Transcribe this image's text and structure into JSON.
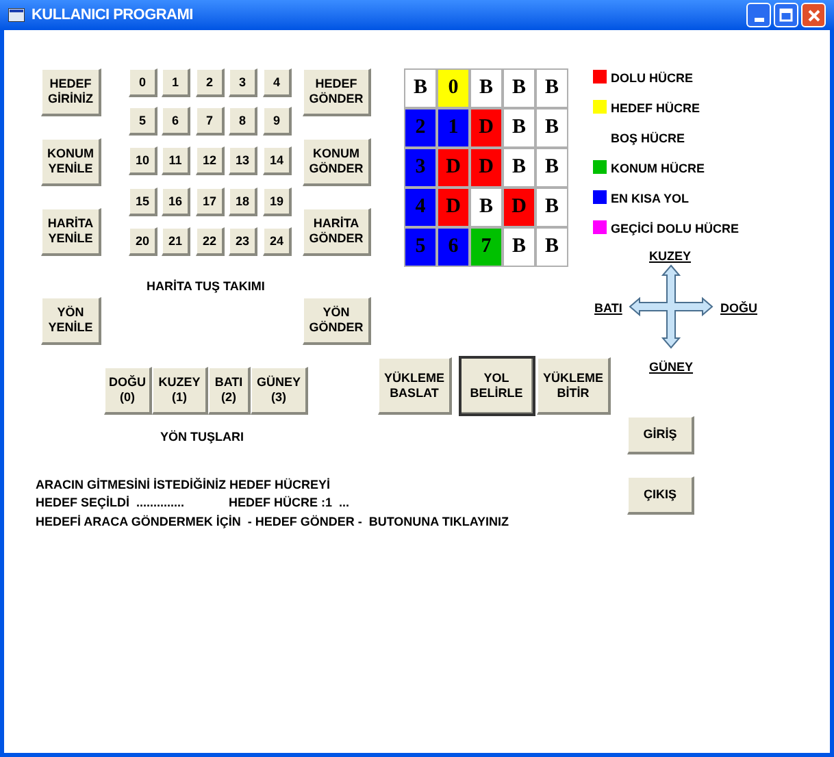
{
  "window": {
    "title": "KULLANICI PROGRAMI"
  },
  "left_buttons": [
    "HEDEF GİRİNİZ",
    "KONUM YENİLE",
    "HARİTA YENİLE",
    "YÖN YENİLE"
  ],
  "right_buttons": [
    "HEDEF GÖNDER",
    "KONUM GÖNDER",
    "HARİTA GÖNDER",
    "YÖN GÖNDER"
  ],
  "keypad": {
    "keys": [
      "0",
      "1",
      "2",
      "3",
      "4",
      "5",
      "6",
      "7",
      "8",
      "9",
      "10",
      "11",
      "12",
      "13",
      "14",
      "15",
      "16",
      "17",
      "18",
      "19",
      "20",
      "21",
      "22",
      "23",
      "24"
    ],
    "label": "HARİTA TUŞ TAKIMI"
  },
  "map_grid": [
    [
      {
        "text": "B",
        "color": "#ffffff"
      },
      {
        "text": "0",
        "color": "#ffff00"
      },
      {
        "text": "B",
        "color": "#ffffff"
      },
      {
        "text": "B",
        "color": "#ffffff"
      },
      {
        "text": "B",
        "color": "#ffffff"
      }
    ],
    [
      {
        "text": "2",
        "color": "#0000ff"
      },
      {
        "text": "1",
        "color": "#0000ff"
      },
      {
        "text": "D",
        "color": "#ff0000"
      },
      {
        "text": "B",
        "color": "#ffffff"
      },
      {
        "text": "B",
        "color": "#ffffff"
      }
    ],
    [
      {
        "text": "3",
        "color": "#0000ff"
      },
      {
        "text": "D",
        "color": "#ff0000"
      },
      {
        "text": "D",
        "color": "#ff0000"
      },
      {
        "text": "B",
        "color": "#ffffff"
      },
      {
        "text": "B",
        "color": "#ffffff"
      }
    ],
    [
      {
        "text": "4",
        "color": "#0000ff"
      },
      {
        "text": "D",
        "color": "#ff0000"
      },
      {
        "text": "B",
        "color": "#ffffff"
      },
      {
        "text": "D",
        "color": "#ff0000"
      },
      {
        "text": "B",
        "color": "#ffffff"
      }
    ],
    [
      {
        "text": "5",
        "color": "#0000ff"
      },
      {
        "text": "6",
        "color": "#0000ff"
      },
      {
        "text": "7",
        "color": "#00c000"
      },
      {
        "text": "B",
        "color": "#ffffff"
      },
      {
        "text": "B",
        "color": "#ffffff"
      }
    ]
  ],
  "legend": [
    {
      "label": "DOLU HÜCRE",
      "color": "#ff0000"
    },
    {
      "label": "HEDEF HÜCRE",
      "color": "#ffff00"
    },
    {
      "label": "BOŞ HÜCRE"
    },
    {
      "label": "KONUM HÜCRE",
      "color": "#00c000"
    },
    {
      "label": "EN KISA YOL",
      "color": "#0000ff"
    },
    {
      "label": "GEÇİCİ DOLU HÜCRE",
      "color": "#ff00ff"
    }
  ],
  "compass": {
    "north": "KUZEY",
    "west": "BATI",
    "east": "DOĞU",
    "south": "GÜNEY"
  },
  "direction_keys": {
    "keys": [
      [
        "DOĞU",
        "(0)"
      ],
      [
        "KUZEY",
        "(1)"
      ],
      [
        "BATI",
        "(2)"
      ],
      [
        "GÜNEY",
        "(3)"
      ]
    ],
    "label": "YÖN TUŞLARI"
  },
  "load_buttons": [
    {
      "label": [
        "YÜKLEME",
        "BASLAT"
      ],
      "focused": false
    },
    {
      "label": [
        "YOL",
        "BELİRLE"
      ],
      "focused": true
    },
    {
      "label": [
        "YÜKLEME",
        "BİTİR"
      ],
      "focused": false
    }
  ],
  "side_buttons": [
    "GİRİŞ",
    "ÇIKIŞ"
  ],
  "messages": {
    "line_1": "ARACIN GİTMESİNİ İSTEDİĞİNİZ HEDEF HÜCREYİ",
    "selected": "HEDEF SEÇİLDİ  ..............",
    "target": "HEDEF HÜCRE :1  ...",
    "line_3": "HEDEFİ ARACA GÖNDERMEK İÇİN  - HEDEF GÖNDER -  BUTONUNA TIKLAYINIZ"
  }
}
